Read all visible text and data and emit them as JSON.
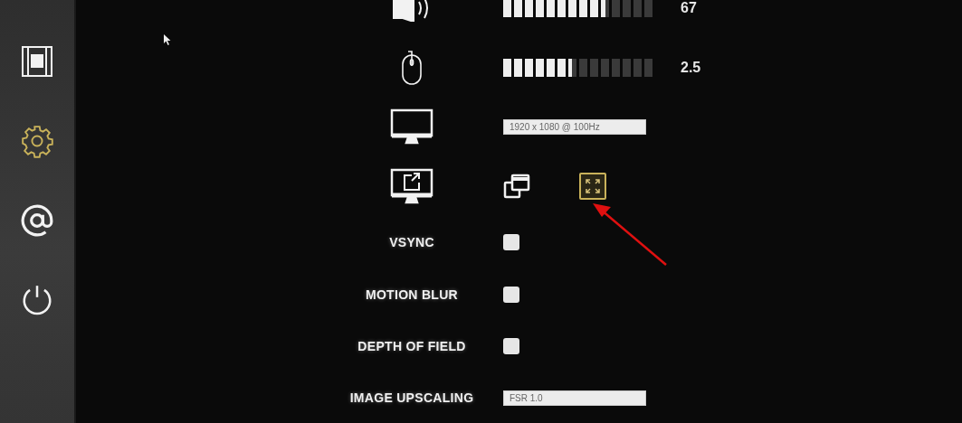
{
  "sidebar": {
    "items": [
      {
        "kind": "film",
        "selected": false
      },
      {
        "kind": "gear",
        "selected": true
      },
      {
        "kind": "at",
        "selected": false
      },
      {
        "kind": "power",
        "selected": false
      }
    ]
  },
  "settings": [
    {
      "kind": "slider",
      "level": 0.67,
      "reading": "67"
    },
    {
      "kind": "slider",
      "level": 0.45,
      "reading": "2.5"
    },
    {
      "kind": "dropdown",
      "value": "1920 x 1080 @ 100Hz"
    },
    {
      "kind": "mode",
      "options": [
        {
          "kind": "windowed",
          "selected": false
        },
        {
          "kind": "fullscreen",
          "selected": true
        }
      ]
    },
    {
      "kind": "checkbox",
      "label": "VSYNC",
      "checked": false
    },
    {
      "kind": "checkbox",
      "label": "MOTION BLUR",
      "checked": false
    },
    {
      "kind": "checkbox",
      "label": "DEPTH OF FIELD",
      "checked": false
    },
    {
      "kind": "dropdown",
      "label": "IMAGE UPSCALING",
      "value": "FSR 1.0"
    }
  ]
}
